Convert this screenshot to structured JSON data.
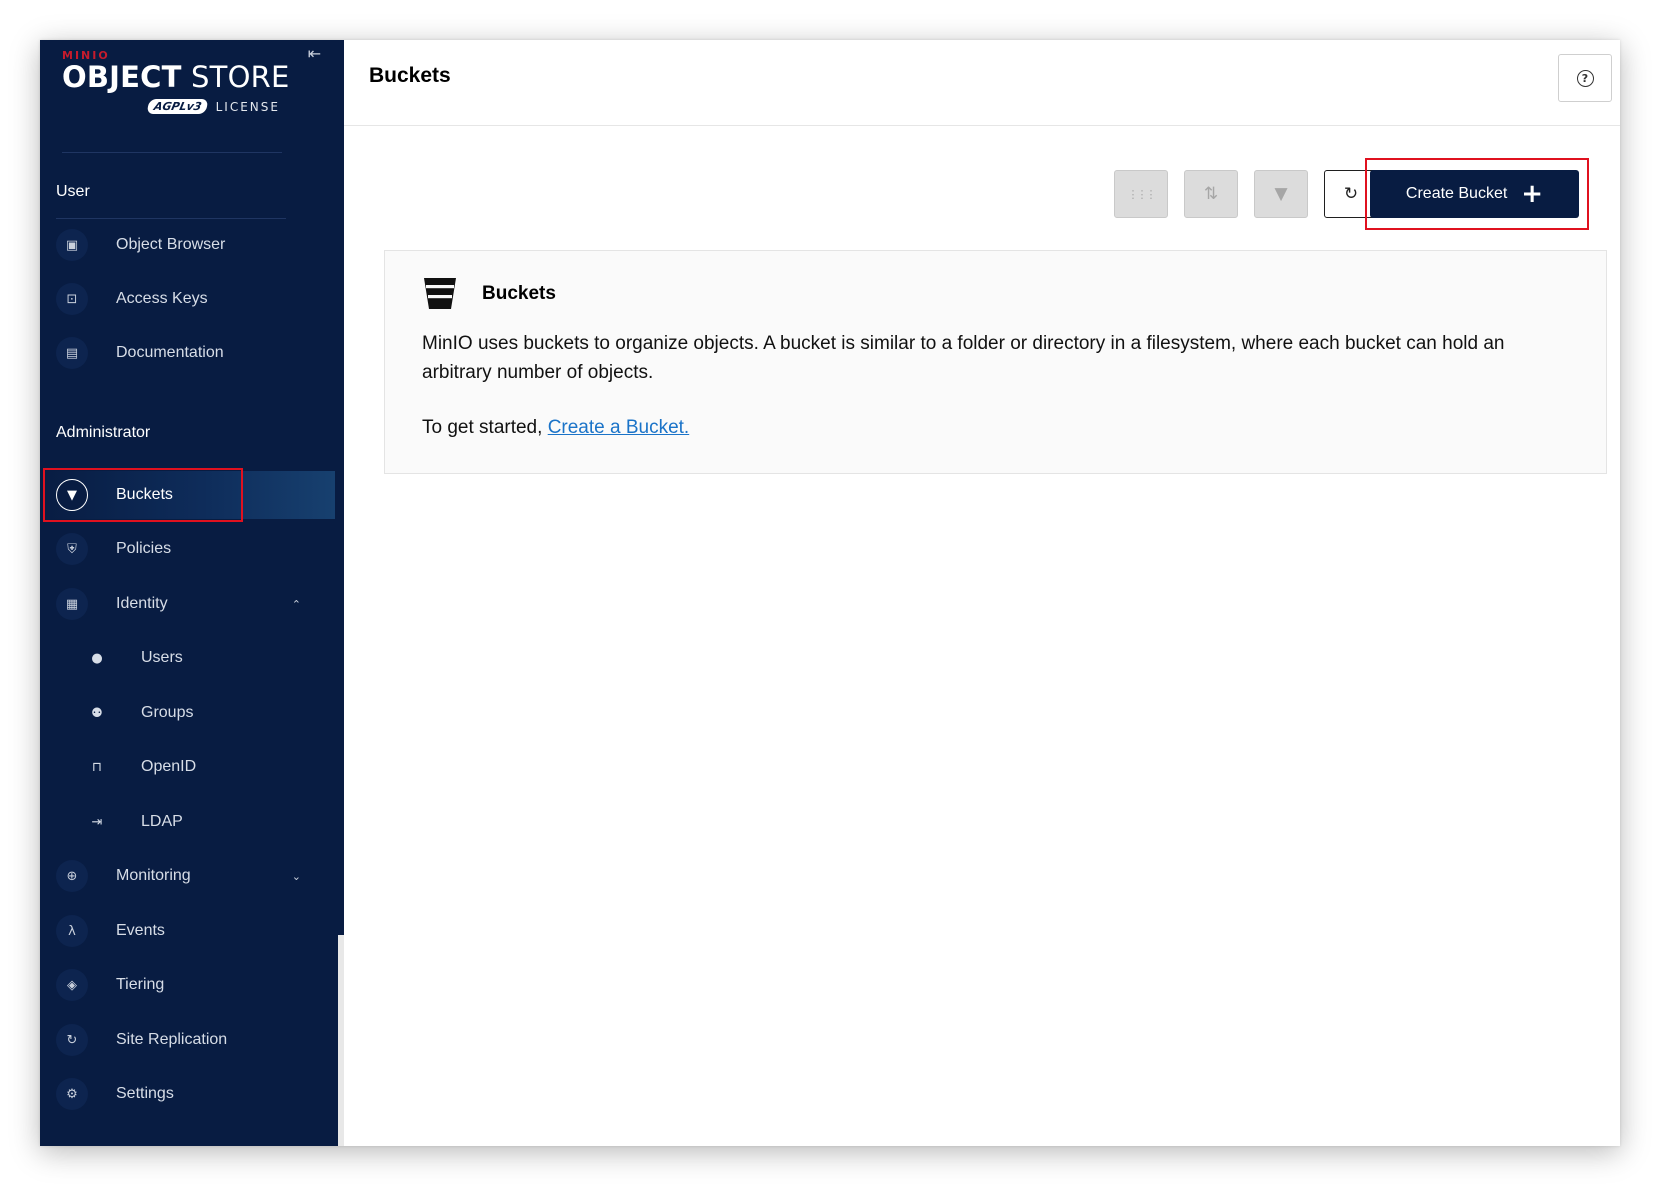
{
  "brand": {
    "minio": "MINIO",
    "title_bold": "OBJECT",
    "title_light": " STORE",
    "badge": "AGPLv3",
    "license": "LICENSE",
    "collapse_glyph": "⇤"
  },
  "sidebar": {
    "sections": {
      "user": "User",
      "administrator": "Administrator"
    },
    "user_items": [
      {
        "label": "Object Browser",
        "icon": "object-browser-icon",
        "glyph": "▣"
      },
      {
        "label": "Access Keys",
        "icon": "access-keys-icon",
        "glyph": "⊡"
      },
      {
        "label": "Documentation",
        "icon": "documentation-icon",
        "glyph": "▤"
      }
    ],
    "admin_items": [
      {
        "label": "Buckets",
        "icon": "bucket-icon",
        "glyph": "▼",
        "active": true
      },
      {
        "label": "Policies",
        "icon": "shield-icon",
        "glyph": "⛨"
      },
      {
        "label": "Identity",
        "icon": "identity-icon",
        "glyph": "▦",
        "caret": "⌃"
      },
      {
        "label": "Users",
        "icon": "user-icon",
        "glyph": "●",
        "sub": true
      },
      {
        "label": "Groups",
        "icon": "groups-icon",
        "glyph": "⚉",
        "sub": true
      },
      {
        "label": "OpenID",
        "icon": "lock-icon",
        "glyph": "⊓",
        "sub": true
      },
      {
        "label": "LDAP",
        "icon": "login-icon",
        "glyph": "⇥",
        "sub": true
      },
      {
        "label": "Monitoring",
        "icon": "monitoring-icon",
        "glyph": "⊕",
        "caret": "⌄"
      },
      {
        "label": "Events",
        "icon": "lambda-icon",
        "glyph": "λ"
      },
      {
        "label": "Tiering",
        "icon": "layers-icon",
        "glyph": "◈"
      },
      {
        "label": "Site Replication",
        "icon": "replication-icon",
        "glyph": "↻"
      },
      {
        "label": "Settings",
        "icon": "gear-icon",
        "glyph": "⚙"
      }
    ]
  },
  "header": {
    "title": "Buckets",
    "help_glyph": "?"
  },
  "toolbar": {
    "grid_glyph": "⋮⋮⋮",
    "replicate_glyph": "⇅",
    "bucket_glyph": "▼",
    "refresh_glyph": "↻",
    "create_label": "Create Bucket",
    "create_plus": "+"
  },
  "info": {
    "title": "Buckets",
    "description": "MinIO uses buckets to organize objects. A bucket is similar to a folder or directory in a filesystem, where each bucket can hold an arbitrary number of objects.",
    "started_prefix": "To get started, ",
    "started_link": "Create a Bucket."
  },
  "colors": {
    "sidebar_bg": "#081c42",
    "accent_red": "#e0111f",
    "brand_red": "#c51b2c",
    "link": "#1a73c8"
  }
}
